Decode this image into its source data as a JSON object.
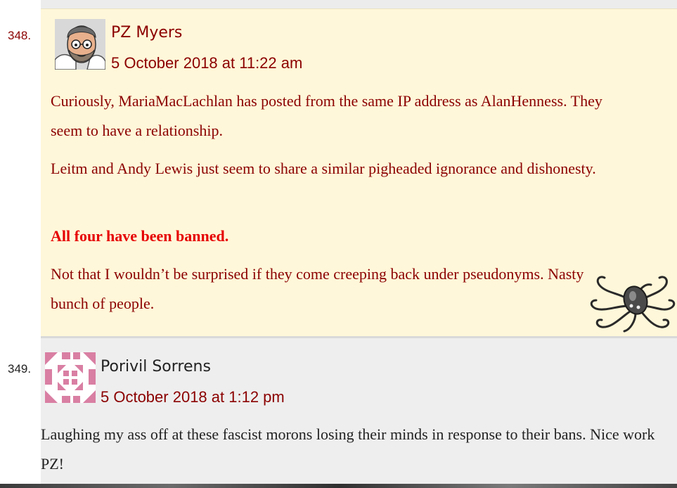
{
  "comments": [
    {
      "number": "348.",
      "author": "PZ Myers",
      "date": "5 October 2018 at 11:22 am",
      "avatar_icon": "cartoon-avatar-icon",
      "paragraphs": [
        "Curiously, MariaMacLachlan has posted from the same IP address as AlanHenness. They seem to have a relationship.",
        "Leitm and Andy Lewis just seem to share a similar pigheaded ignorance and dishonesty.",
        "All four have been banned.",
        "Not that I wouldn’t be surprised if they come creeping back under pseudonyms. Nasty bunch of people."
      ],
      "badge_icon": "octopus-icon"
    },
    {
      "number": "349.",
      "author": "Porivil Sorrens",
      "date": "5 October 2018 at 1:12 pm",
      "avatar_icon": "identicon-icon",
      "paragraphs": [
        "Laughing my ass off at these fascist morons losing their minds in response to their bans. Nice work PZ!"
      ]
    }
  ],
  "colors": {
    "author_highlight_bg": "#fff7d9",
    "normal_bg": "#eeeeee",
    "link_red": "#8b0000",
    "emphasis_red": "#e60000",
    "identicon_pink": "#d97fa3"
  }
}
